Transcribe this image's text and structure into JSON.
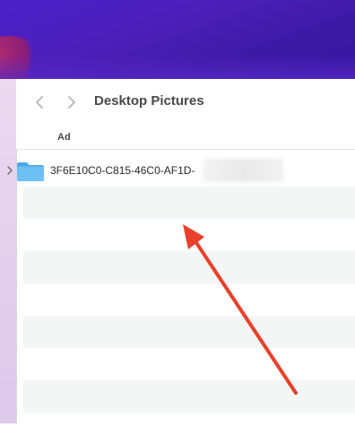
{
  "window": {
    "title": "Desktop Pictures"
  },
  "toolbar": {
    "back_icon": "chevron-left-icon",
    "forward_icon": "chevron-right-icon"
  },
  "list": {
    "column_header": "Ad",
    "items": [
      {
        "name": "3F6E10C0-C815-46C0-AF1D-",
        "icon": "folder-icon",
        "disclosure": "chevron-right-icon"
      }
    ]
  },
  "annotation": {
    "arrow_color": "#e8402a"
  }
}
